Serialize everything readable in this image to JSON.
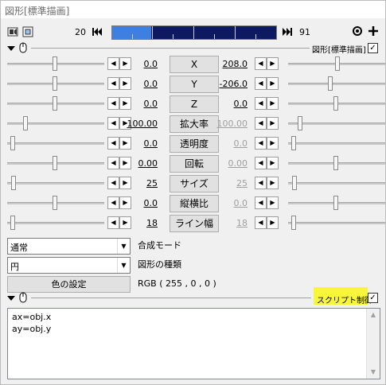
{
  "window": {
    "title": "図形[標準描画]"
  },
  "toolbar": {
    "frame_start": "20",
    "frame_end": "91",
    "timeline_progress": 0.24
  },
  "object_header": {
    "label": "図形[標準描画]",
    "checked": "✓"
  },
  "params": [
    {
      "name": "X",
      "left": "0.0",
      "right": "208.0",
      "right_disabled": false,
      "left_thumb": 0.48,
      "right_thumb": 0.5
    },
    {
      "name": "Y",
      "left": "0.0",
      "right": "-206.0",
      "right_disabled": false,
      "left_thumb": 0.48,
      "right_thumb": 0.42
    },
    {
      "name": "Z",
      "left": "0.0",
      "right": "0.0",
      "right_disabled": false,
      "left_thumb": 0.48,
      "right_thumb": 0.48
    },
    {
      "name": "拡大率",
      "left": "100.00",
      "right": "100.00",
      "right_disabled": true,
      "left_thumb": 0.17,
      "right_thumb": 0.1
    },
    {
      "name": "透明度",
      "left": "0.0",
      "right": "0.0",
      "right_disabled": true,
      "left_thumb": 0.03,
      "right_thumb": 0.03
    },
    {
      "name": "回転",
      "left": "0.00",
      "right": "0.00",
      "right_disabled": true,
      "left_thumb": 0.48,
      "right_thumb": 0.48
    },
    {
      "name": "サイズ",
      "left": "25",
      "right": "25",
      "right_disabled": true,
      "left_thumb": 0.04,
      "right_thumb": 0.04
    },
    {
      "name": "縦横比",
      "left": "0.0",
      "right": "0.0",
      "right_disabled": true,
      "left_thumb": 0.48,
      "right_thumb": 0.48
    },
    {
      "name": "ライン幅",
      "left": "18",
      "right": "18",
      "right_disabled": true,
      "left_thumb": 0.03,
      "right_thumb": 0.03
    }
  ],
  "blend": {
    "value": "通常",
    "label": "合成モード"
  },
  "shape": {
    "value": "円",
    "label": "図形の種類"
  },
  "color": {
    "button": "色の設定",
    "value": "RGB ( 255 , 0 , 0 )"
  },
  "script_section": {
    "label": "スクリプト制御",
    "checked": "✓",
    "lines": [
      "ax=obj.x",
      "ay=obj.y"
    ]
  },
  "colors": {
    "timeline_bg": "#0e1a60",
    "timeline_fill": "#3f7fe0",
    "highlight": "#f9f63a"
  }
}
